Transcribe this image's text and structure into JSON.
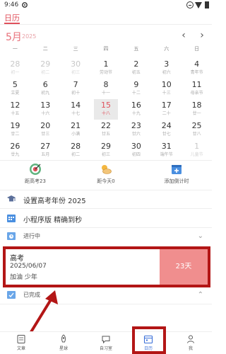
{
  "status_bar": {
    "time": "9:46"
  },
  "top_tab": {
    "label": "日历"
  },
  "calendar": {
    "month": "5月",
    "year": "2025",
    "prev_symbol": "‹",
    "next_symbol": "›",
    "weekdays": [
      "一",
      "二",
      "三",
      "四",
      "五",
      "六",
      "日"
    ],
    "weeks": [
      [
        {
          "day": "28",
          "lunar": "初一",
          "muted": true
        },
        {
          "day": "29",
          "lunar": "初二",
          "muted": true
        },
        {
          "day": "30",
          "lunar": "初三",
          "muted": true
        },
        {
          "day": "1",
          "lunar": "劳动节",
          "muted": false
        },
        {
          "day": "2",
          "lunar": "初五",
          "muted": false
        },
        {
          "day": "3",
          "lunar": "初六",
          "muted": false
        },
        {
          "day": "4",
          "lunar": "青年节",
          "muted": false
        }
      ],
      [
        {
          "day": "5",
          "lunar": "立夏",
          "muted": false
        },
        {
          "day": "6",
          "lunar": "初九",
          "muted": false
        },
        {
          "day": "7",
          "lunar": "初十",
          "muted": false
        },
        {
          "day": "8",
          "lunar": "十一",
          "muted": false
        },
        {
          "day": "9",
          "lunar": "十二",
          "muted": false
        },
        {
          "day": "10",
          "lunar": "十三",
          "muted": false
        },
        {
          "day": "11",
          "lunar": "母亲节",
          "muted": false
        }
      ],
      [
        {
          "day": "12",
          "lunar": "十五",
          "muted": false
        },
        {
          "day": "13",
          "lunar": "十六",
          "muted": false
        },
        {
          "day": "14",
          "lunar": "十七",
          "muted": false
        },
        {
          "day": "15",
          "lunar": "十八",
          "muted": false,
          "today": true
        },
        {
          "day": "16",
          "lunar": "十九",
          "muted": false
        },
        {
          "day": "17",
          "lunar": "二十",
          "muted": false
        },
        {
          "day": "18",
          "lunar": "廿一",
          "muted": false
        }
      ],
      [
        {
          "day": "19",
          "lunar": "廿二",
          "muted": false
        },
        {
          "day": "20",
          "lunar": "廿三",
          "muted": false
        },
        {
          "day": "21",
          "lunar": "小满",
          "muted": false
        },
        {
          "day": "22",
          "lunar": "廿五",
          "muted": false
        },
        {
          "day": "23",
          "lunar": "廿六",
          "muted": false
        },
        {
          "day": "24",
          "lunar": "廿七",
          "muted": false
        },
        {
          "day": "25",
          "lunar": "廿八",
          "muted": false
        }
      ],
      [
        {
          "day": "26",
          "lunar": "廿九",
          "muted": false
        },
        {
          "day": "27",
          "lunar": "五月",
          "muted": false
        },
        {
          "day": "28",
          "lunar": "初二",
          "muted": false
        },
        {
          "day": "29",
          "lunar": "初三",
          "muted": false
        },
        {
          "day": "30",
          "lunar": "初四",
          "muted": false
        },
        {
          "day": "31",
          "lunar": "端午节",
          "muted": false
        },
        {
          "day": "1",
          "lunar": "儿童节",
          "muted": true
        }
      ]
    ]
  },
  "tools": [
    {
      "label": "距高考23",
      "icon": "target-icon"
    },
    {
      "label": "距今天0",
      "icon": "sun-cloud-icon"
    },
    {
      "label": "添加倒计时",
      "icon": "calendar-add-icon"
    }
  ],
  "settings_rows": {
    "exam_year": {
      "label": "设置高考年份  2025",
      "icon": "graduation-cap-icon"
    },
    "mini_program": {
      "label": "小程序版  精确到秒",
      "icon": "calendar-grid-icon"
    }
  },
  "in_progress": {
    "label": "进行中",
    "icon": "calendar-clock-icon",
    "chevron": "⌄"
  },
  "countdown_card": {
    "title": "高考",
    "date": "2025/06/07",
    "note": "加油 少年",
    "remaining": "23天"
  },
  "completed": {
    "label": "已完成",
    "icon": "calendar-check-icon",
    "chevron": "⌃"
  },
  "bottom_nav": [
    {
      "label": "文章",
      "icon": "article-icon",
      "active": false
    },
    {
      "label": "星球",
      "icon": "rocket-icon",
      "active": false
    },
    {
      "label": "自习室",
      "icon": "chat-bubble-icon",
      "active": false
    },
    {
      "label": "日历",
      "icon": "calendar-icon",
      "active": true
    },
    {
      "label": "我",
      "icon": "user-icon",
      "active": false
    }
  ],
  "colors": {
    "accent": "#e0505b",
    "highlight_border": "#b31616",
    "countdown_fill": "#f08e8e",
    "active_nav": "#3a6fd8"
  }
}
